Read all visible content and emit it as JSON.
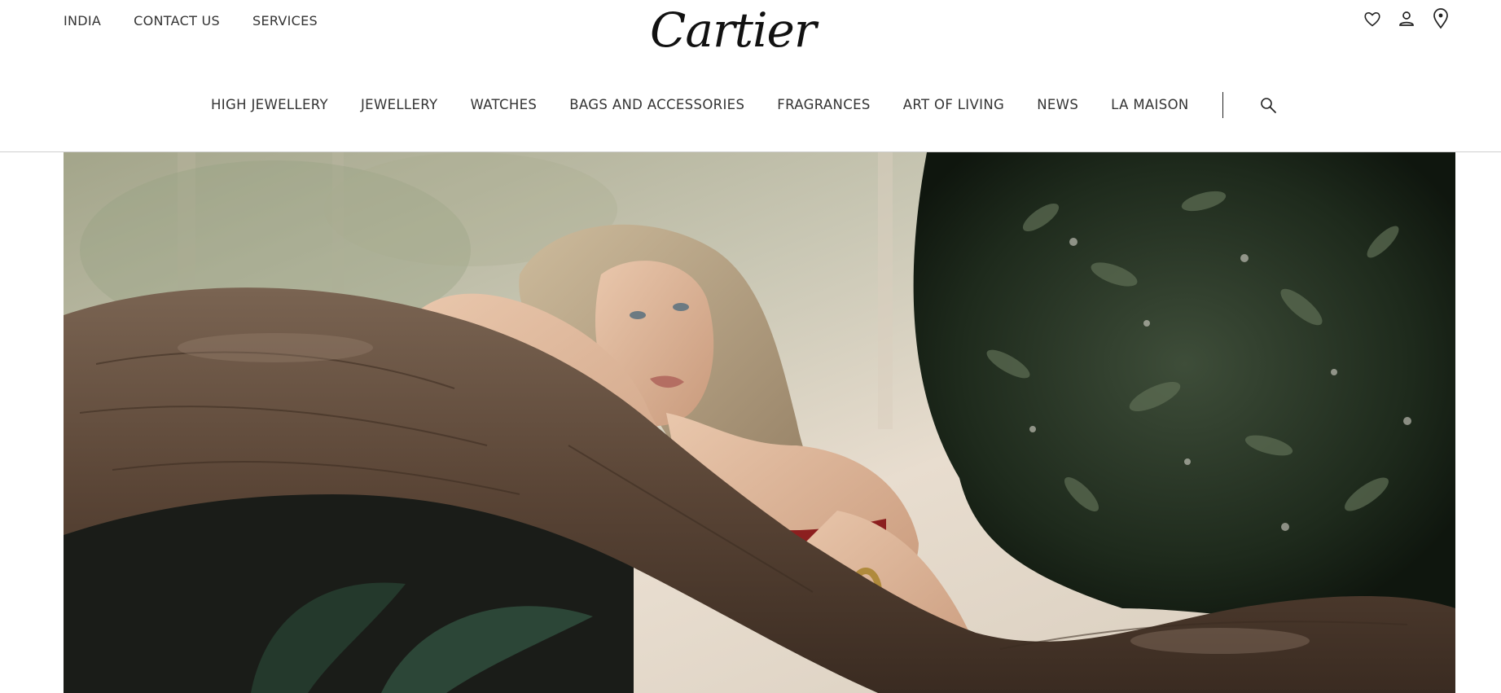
{
  "header": {
    "utility_links": [
      "INDIA",
      "CONTACT US",
      "SERVICES"
    ],
    "logo_text": "Cartier",
    "icons": [
      "heart-icon",
      "user-icon",
      "location-pin-icon"
    ],
    "nav_items": [
      "HIGH JEWELLERY",
      "JEWELLERY",
      "WATCHES",
      "BAGS AND ACCESSORIES",
      "FRAGRANCES",
      "ART OF LIVING",
      "NEWS",
      "LA MAISON"
    ],
    "search_icon": "search-icon"
  },
  "colors": {
    "text": "#333333",
    "background": "#ffffff",
    "divider": "#cfcfcf"
  }
}
